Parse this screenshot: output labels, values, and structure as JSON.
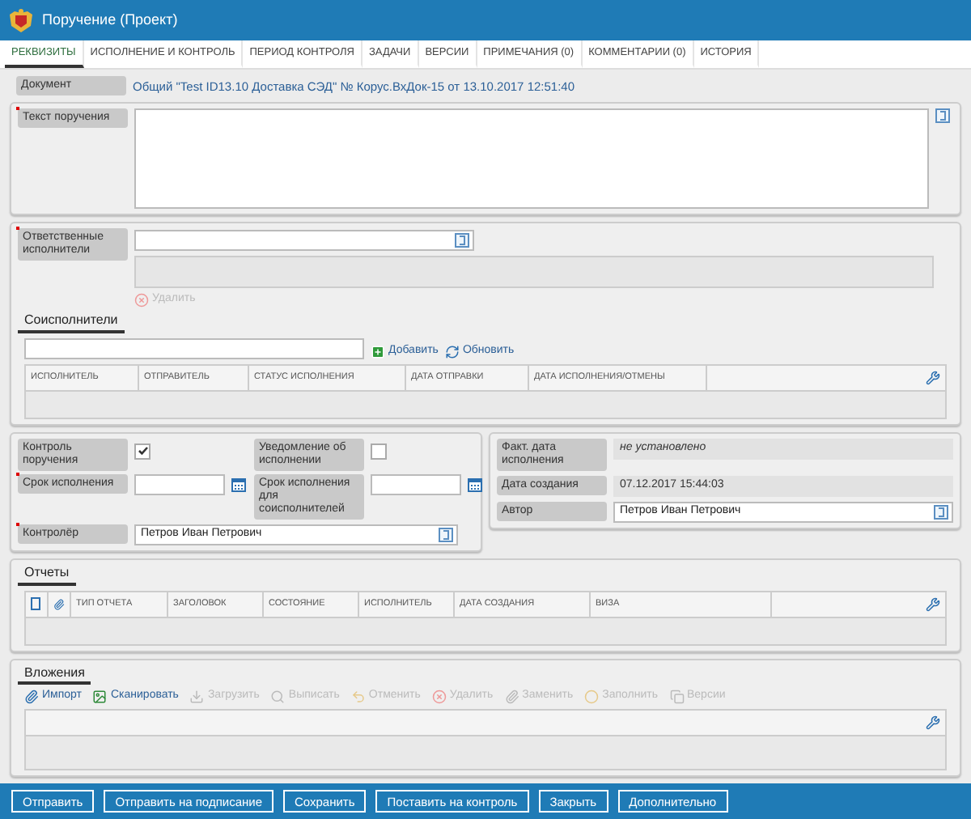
{
  "window": {
    "title": "Поручение (Проект)"
  },
  "tabs": [
    {
      "label": "РЕКВИЗИТЫ",
      "selected": true
    },
    {
      "label": "ИСПОЛНЕНИЕ И КОНТРОЛЬ",
      "selected": false
    },
    {
      "label": "ПЕРИОД КОНТРОЛЯ",
      "selected": false
    },
    {
      "label": "ЗАДАЧИ",
      "selected": false
    },
    {
      "label": "ВЕРСИИ",
      "selected": false
    },
    {
      "label": "ПРИМЕЧАНИЯ (0)",
      "selected": false
    },
    {
      "label": "КОММЕНТАРИИ (0)",
      "selected": false
    },
    {
      "label": "ИСТОРИЯ",
      "selected": false
    }
  ],
  "document": {
    "label": "Документ",
    "link": "Общий \"Test ID13.10 Доставка СЭД\" № Корус.ВхДок-15 от 13.10.2017 12:51:40"
  },
  "task_text": {
    "label": "Текст поручения",
    "required": true
  },
  "responsible": {
    "label": "Ответственные исполнители",
    "required": true,
    "delete_action": {
      "label": "Удалить",
      "disabled": true
    }
  },
  "co_executors": {
    "title": "Соисполнители",
    "actions": [
      {
        "label": "Добавить",
        "kind": "add"
      },
      {
        "label": "Обновить",
        "kind": "refresh"
      }
    ],
    "columns": [
      "ИСПОЛНИТЕЛЬ",
      "ОТПРАВИТЕЛЬ",
      "СТАТУС ИСПОЛНЕНИЯ",
      "ДАТА ОТПРАВКИ",
      "ДАТА ИСПОЛНЕНИЯ/ОТМЕНЫ"
    ]
  },
  "control": [
    {
      "label": "Контроль поручения",
      "kind": "checkbox",
      "checked": true,
      "required": false
    },
    {
      "label": "Уведомление об исполнении",
      "kind": "checkbox",
      "checked": false,
      "required": false
    },
    {
      "label": "Срок исполнения",
      "kind": "date",
      "required": true
    },
    {
      "label": "Срок исполнения для соисполнителей",
      "kind": "date",
      "required": false
    },
    {
      "label": "Контролёр",
      "kind": "person",
      "value": "Петров Иван Петрович",
      "required": true
    }
  ],
  "info": [
    {
      "label": "Факт. дата исполнения",
      "kind": "status",
      "value": "не установлено"
    },
    {
      "label": "Дата создания",
      "kind": "readonly",
      "value": "07.12.2017 15:44:03"
    },
    {
      "label": "Автор",
      "kind": "person",
      "value": "Петров Иван Петрович"
    }
  ],
  "reports": {
    "title": "Отчеты",
    "columns": [
      "ТИП ОТЧЕТА",
      "ЗАГОЛОВОК",
      "СОСТОЯНИЕ",
      "ИСПОЛНИТЕЛЬ",
      "ДАТА СОЗДАНИЯ",
      "ВИЗА"
    ]
  },
  "attachments": {
    "title": "Вложения",
    "toolbar": [
      {
        "label": "Импорт",
        "kind": "clip",
        "disabled": false
      },
      {
        "label": "Сканировать",
        "kind": "scan",
        "disabled": false
      },
      {
        "label": "Загрузить",
        "kind": "load",
        "disabled": true
      },
      {
        "label": "Выписать",
        "kind": "search",
        "disabled": true
      },
      {
        "label": "Отменить",
        "kind": "undo",
        "disabled": true
      },
      {
        "label": "Удалить",
        "kind": "delete",
        "disabled": true
      },
      {
        "label": "Заменить",
        "kind": "clip",
        "disabled": true
      },
      {
        "label": "Заполнить",
        "kind": "fill",
        "disabled": true
      },
      {
        "label": "Версии",
        "kind": "versions",
        "disabled": true
      }
    ]
  },
  "buttons": [
    "Отправить",
    "Отправить на подписание",
    "Сохранить",
    "Поставить на контроль",
    "Закрыть",
    "Дополнительно"
  ]
}
